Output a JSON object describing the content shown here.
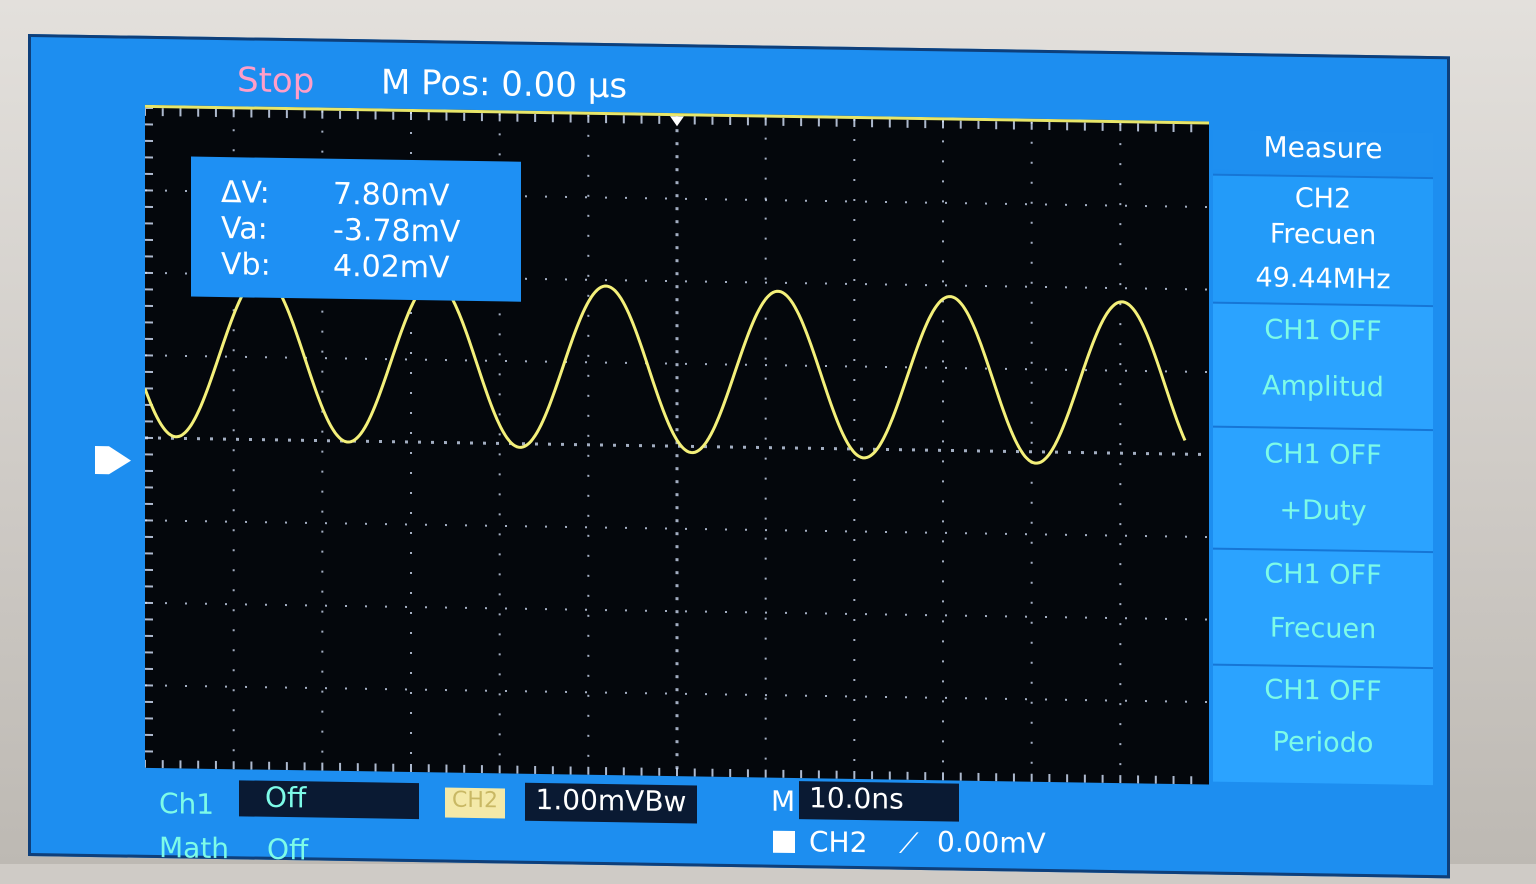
{
  "status": {
    "run_state": "Stop",
    "mpos_label": "M Pos:",
    "mpos_value": "0.00 µs"
  },
  "cursor_readout": {
    "rows": [
      {
        "label": "ΔV:",
        "value": "7.80mV"
      },
      {
        "label": "Va:",
        "value": "-3.78mV"
      },
      {
        "label": "Vb:",
        "value": "4.02mV"
      }
    ]
  },
  "menu": {
    "title": "Measure",
    "items": [
      {
        "line1": "CH2",
        "line2": "Frecuen",
        "line3": "49.44MHz"
      },
      {
        "line1": "CH1 OFF",
        "line2": "Amplitud"
      },
      {
        "line1": "CH1 OFF",
        "line2": "+Duty"
      },
      {
        "line1": "CH1 OFF",
        "line2": "Frecuen"
      },
      {
        "line1": "CH1 OFF",
        "line2": "Periodo"
      }
    ]
  },
  "bottom": {
    "ch1_label": "Ch1",
    "ch1_state": "Off",
    "ch2_tag": "CH2",
    "ch2_scale": "1.00mVBw",
    "m_label": "M",
    "timebase": "10.0ns",
    "math_label": "Math",
    "math_state": "Off",
    "trigger_source": "CH2",
    "trigger_edge": "⟋",
    "trigger_level": "0.00mV"
  },
  "colors": {
    "screen_blue": "#1d8ef0",
    "trace_yellow": "#f4f07a",
    "grid_dots": "#d9e6ff",
    "stop_pink": "#ff9ec8",
    "channel_cyan": "#7dfbe8"
  }
}
